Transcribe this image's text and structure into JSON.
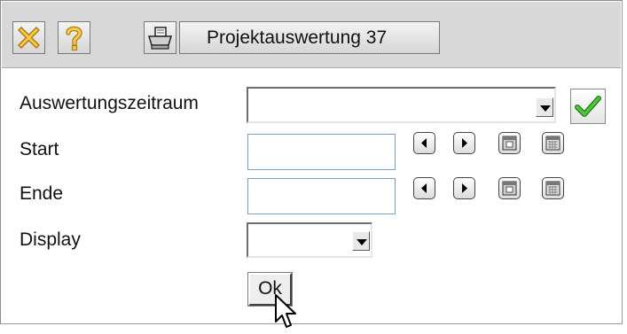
{
  "toolbar": {
    "close_icon": "close-icon",
    "help_icon": "help-icon",
    "print_icon": "printer-icon",
    "title": "Projektauswertung 37"
  },
  "form": {
    "period_label": "Auswertungszeitraum",
    "period_value": "",
    "start_label": "Start",
    "start_value": "",
    "end_label": "Ende",
    "end_value": "",
    "display_label": "Display",
    "display_value": "",
    "ok_label": "Ok"
  },
  "colors": {
    "toolbar_bg": "#d8d8d8",
    "close_icon": "#f0b420",
    "help_icon": "#f0b420",
    "check_icon": "#2a9a1a",
    "field_border": "#7f9db9"
  }
}
